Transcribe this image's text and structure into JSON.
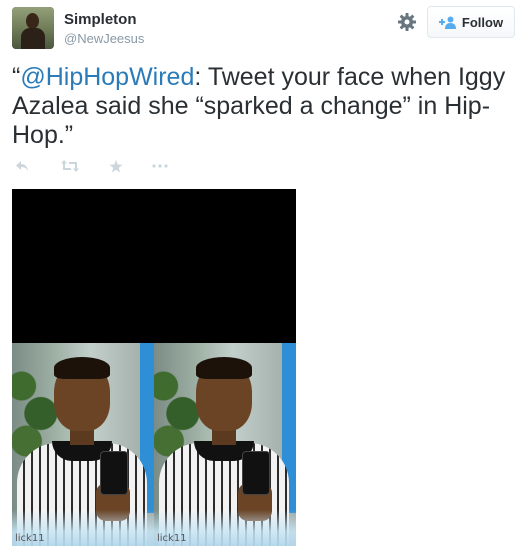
{
  "user": {
    "display_name": "Simpleton",
    "handle": "@NewJeesus"
  },
  "header": {
    "follow_label": "Follow"
  },
  "tweet": {
    "open_quote": "“",
    "mention": "@HipHopWired",
    "text": ": Tweet your face when Iggy Azalea said she “sparked a change” in Hip-Hop.”"
  },
  "media": {
    "watermark_left": "lick11",
    "watermark_right": "lick11"
  },
  "icons": {
    "settings": "gear-icon",
    "follow": "follow-person-plus-icon",
    "reply": "reply-icon",
    "retweet": "retweet-icon",
    "favorite": "star-icon",
    "more": "more-icon"
  },
  "colors": {
    "link": "#2b7bb9",
    "muted": "#8899a6",
    "follow_icon": "#55acee",
    "action_icon": "#ccd6dd"
  }
}
